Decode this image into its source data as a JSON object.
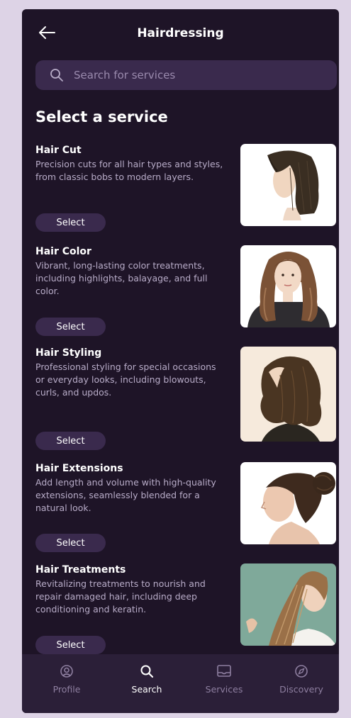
{
  "header": {
    "title": "Hairdressing",
    "back_icon": "arrow-left-icon"
  },
  "search": {
    "placeholder": "Search for services",
    "icon": "search-icon"
  },
  "section_title": "Select a service",
  "services": [
    {
      "name": "Hair Cut",
      "description": "Precision cuts for all hair types and styles, from classic bobs to modern layers.",
      "button": "Select"
    },
    {
      "name": "Hair Color",
      "description": "Vibrant, long-lasting color treatments, including highlights, balayage, and full color.",
      "button": "Select"
    },
    {
      "name": "Hair Styling",
      "description": "Professional styling for special occasions or everyday looks, including blowouts, curls, and updos.",
      "button": "Select"
    },
    {
      "name": "Hair Extensions",
      "description": "Add length and volume with high-quality extensions, seamlessly blended for a natural look.",
      "button": "Select"
    },
    {
      "name": "Hair Treatments",
      "description": "Revitalizing treatments to nourish and repair damaged hair, including deep conditioning and keratin.",
      "button": "Select"
    }
  ],
  "nav": [
    {
      "label": "Profile",
      "icon": "profile-icon",
      "active": false
    },
    {
      "label": "Search",
      "icon": "search-icon",
      "active": true
    },
    {
      "label": "Services",
      "icon": "services-icon",
      "active": false
    },
    {
      "label": "Discovery",
      "icon": "compass-icon",
      "active": false
    }
  ],
  "colors": {
    "background": "#1e1427",
    "surface": "#3a2a4d",
    "nav_background": "#2b1f38",
    "text_primary": "#ffffff",
    "text_secondary": "#b8acc8",
    "text_muted": "#8e7fa0"
  }
}
